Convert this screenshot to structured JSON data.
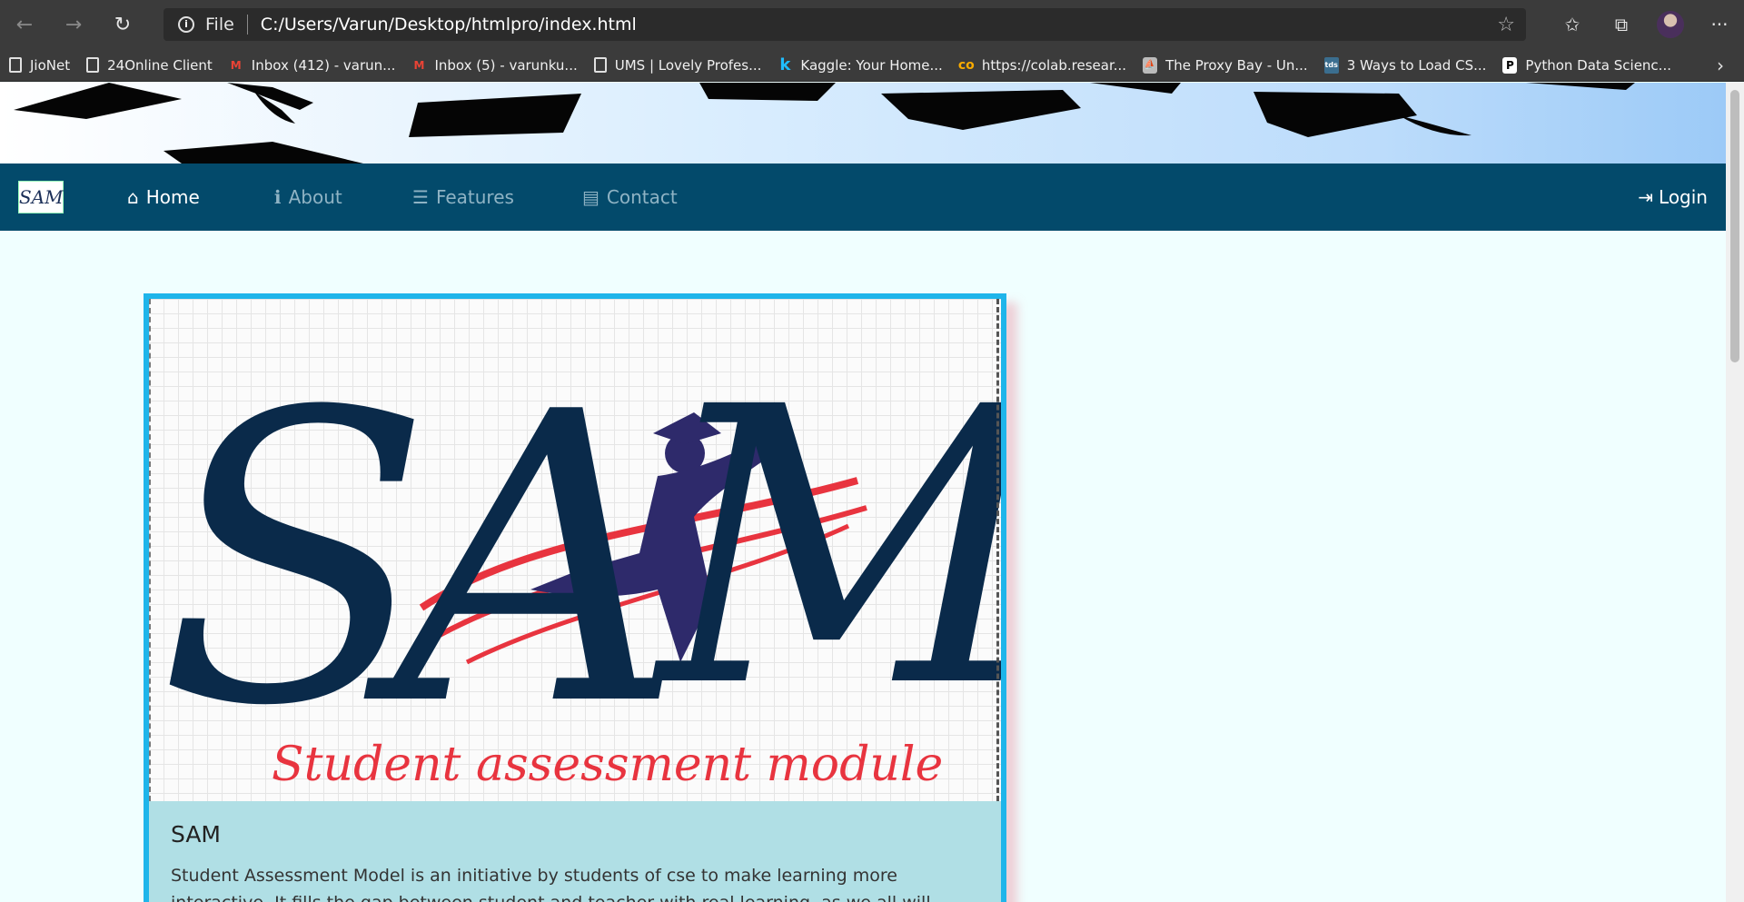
{
  "browser": {
    "scheme_label": "File",
    "url": "C:/Users/Varun/Desktop/htmlpro/index.html",
    "bookmarks": [
      {
        "label": "JioNet",
        "icon": "page-icon"
      },
      {
        "label": "24Online Client",
        "icon": "page-icon"
      },
      {
        "label": "Inbox (412) - varun...",
        "icon": "gmail-icon"
      },
      {
        "label": "Inbox (5) - varunku...",
        "icon": "gmail-icon"
      },
      {
        "label": "UMS | Lovely Profes...",
        "icon": "page-icon"
      },
      {
        "label": "Kaggle: Your Home...",
        "icon": "kaggle-icon"
      },
      {
        "label": "https://colab.resear...",
        "icon": "colab-icon"
      },
      {
        "label": "The Proxy Bay - Un...",
        "icon": "pirate-ship-icon"
      },
      {
        "label": "3 Ways to Load CS...",
        "icon": "tds-icon"
      },
      {
        "label": "Python Data Scienc...",
        "icon": "p-icon"
      }
    ]
  },
  "navbar": {
    "logo_text": "SAM",
    "items": [
      {
        "label": "Home",
        "icon": "home-icon"
      },
      {
        "label": "About",
        "icon": "info-icon"
      },
      {
        "label": "Features",
        "icon": "list-icon"
      },
      {
        "label": "Contact",
        "icon": "contact-card-icon"
      }
    ],
    "login_label": "Login"
  },
  "card": {
    "logo_title": "SAM",
    "logo_subtitle": "Student assessment module",
    "title": "SAM",
    "text": "Student Assessment Model is an initiative by students of cse to make learning more interactive. It fills the gap between student and teacher with real learning, as we all will become stronger."
  },
  "colors": {
    "navbar_bg": "#034a6b",
    "card_border": "#1fb5ea",
    "card_body_bg": "#b0dfe5",
    "page_bg": "#f0ffff",
    "logo_navy": "#0a2a4a",
    "logo_red": "#e8343f",
    "logo_purple": "#2e2a6b"
  }
}
